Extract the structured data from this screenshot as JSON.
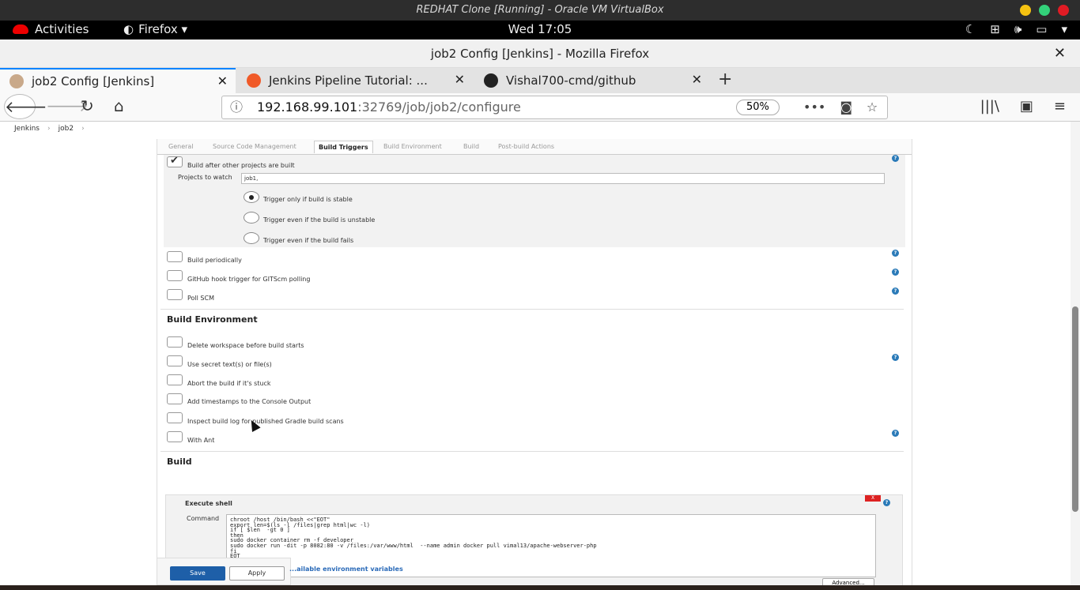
{
  "vbox": {
    "title": "REDHAT Clone [Running] - Oracle VM VirtualBox",
    "dot_colors": [
      "#f5c211",
      "#33d17a",
      "#e01b24"
    ]
  },
  "gnome": {
    "activities": "Activities",
    "app_menu": "Firefox ▾",
    "clock": "Wed 17:05",
    "tray_icons": [
      "night-light-icon",
      "network-icon",
      "volume-icon",
      "battery-icon",
      "system-menu-icon"
    ]
  },
  "firefox": {
    "window_title": "job2 Config [Jenkins] - Mozilla Firefox",
    "close": "✕",
    "tabs": [
      {
        "label": "job2 Config [Jenkins]",
        "icon": "jenkins-icon",
        "icon_color": "#c9a98a"
      },
      {
        "label": "Jenkins Pipeline Tutorial: ...",
        "icon": "edureka-icon",
        "icon_color": "#f05a28"
      },
      {
        "label": "Vishal700-cmd/github",
        "icon": "github-icon",
        "icon_color": "#222222"
      }
    ],
    "tab_close": "✕",
    "new_tab": "+",
    "nav": {
      "back": "🡐",
      "forward": "🡒",
      "reload": "↻",
      "home": "⌂"
    },
    "url": {
      "info_icon": "ⓘ",
      "host": "192.168.99.101",
      "path": ":32769/job/job2/configure",
      "zoom": "50%"
    },
    "url_actions": [
      "•••",
      "◙",
      "☆"
    ],
    "tools": [
      "|||\\",
      "▣",
      "≡"
    ]
  },
  "jenkins": {
    "breadcrumb": [
      "Jenkins",
      "›",
      "job2",
      "›"
    ],
    "config_tabs": [
      "General",
      "Source Code Management",
      "Build Triggers",
      "Build Environment",
      "Build",
      "Post-build Actions"
    ],
    "active_tab": "Build Triggers",
    "triggers": {
      "build_after": "Build after other projects are built",
      "projects_label": "Projects to watch",
      "projects_value": "job1,",
      "radio_stable": "Trigger only if build is stable",
      "radio_unstable": "Trigger even if the build is unstable",
      "radio_fails": "Trigger even if the build fails",
      "periodically": "Build periodically",
      "github_hook": "GitHub hook trigger for GITScm polling",
      "poll_scm": "Poll SCM"
    },
    "build_env": {
      "title": "Build Environment",
      "delete_ws": "Delete workspace before build starts",
      "secret_text": "Use secret text(s) or file(s)",
      "abort_stuck": "Abort the build if it's stuck",
      "timestamps": "Add timestamps to the Console Output",
      "gradle": "Inspect build log for published Gradle build scans",
      "with_ant": "With Ant"
    },
    "build": {
      "title": "Build",
      "step_title": "Execute shell",
      "delete": "X",
      "command_label": "Command",
      "command": "chroot /host /bin/bash <<\"EOT\"\nexport len=$(ls -l /files|grep html|wc -l)\nif [ $len  -gt 0 ]\nthen\nsudo docker container rm -f developer\nsudo docker run -dit -p 8082:80 -v /files:/var/www/html  --name admin docker pull vimal13/apache-webserver-php\nfi\nEOT",
      "env_link": "...ailable environment variables",
      "advanced": "Advanced..."
    },
    "buttons": {
      "save": "Save",
      "apply": "Apply"
    },
    "help": "?"
  }
}
